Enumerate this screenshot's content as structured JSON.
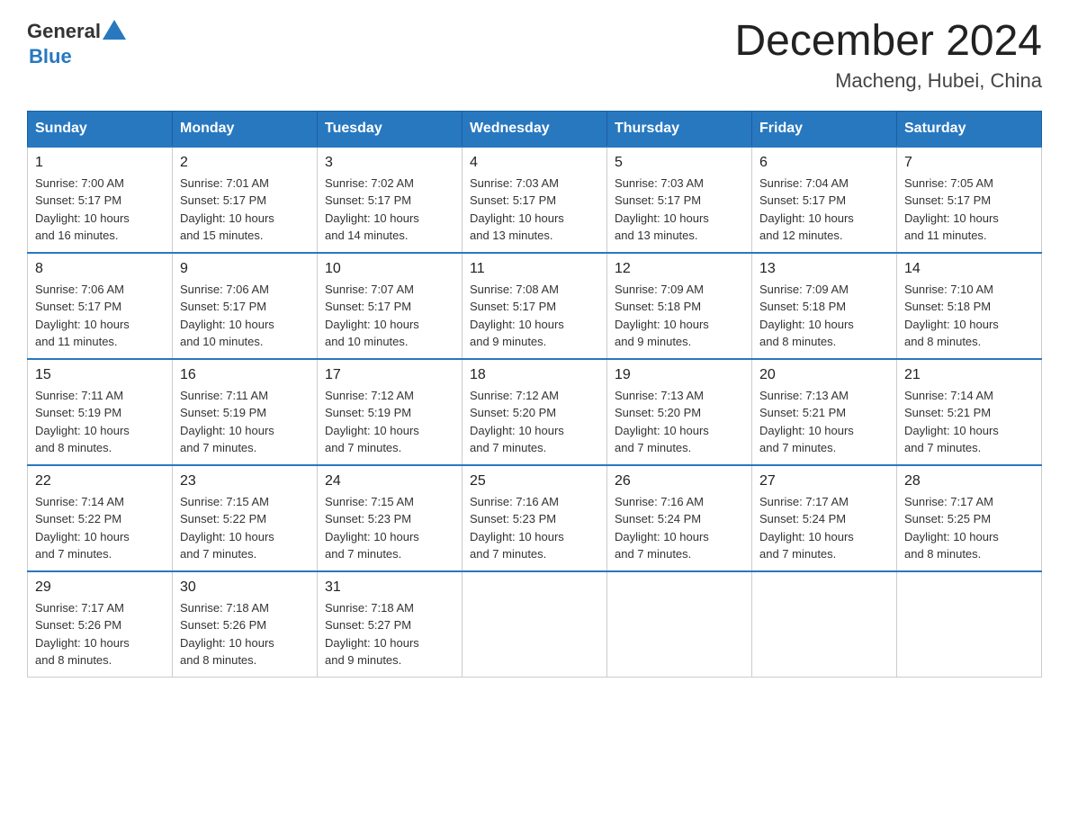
{
  "header": {
    "logo_general": "General",
    "logo_blue": "Blue",
    "title": "December 2024",
    "subtitle": "Macheng, Hubei, China"
  },
  "days_of_week": [
    "Sunday",
    "Monday",
    "Tuesday",
    "Wednesday",
    "Thursday",
    "Friday",
    "Saturday"
  ],
  "weeks": [
    [
      {
        "day": "1",
        "sunrise": "7:00 AM",
        "sunset": "5:17 PM",
        "daylight": "10 hours and 16 minutes."
      },
      {
        "day": "2",
        "sunrise": "7:01 AM",
        "sunset": "5:17 PM",
        "daylight": "10 hours and 15 minutes."
      },
      {
        "day": "3",
        "sunrise": "7:02 AM",
        "sunset": "5:17 PM",
        "daylight": "10 hours and 14 minutes."
      },
      {
        "day": "4",
        "sunrise": "7:03 AM",
        "sunset": "5:17 PM",
        "daylight": "10 hours and 13 minutes."
      },
      {
        "day": "5",
        "sunrise": "7:03 AM",
        "sunset": "5:17 PM",
        "daylight": "10 hours and 13 minutes."
      },
      {
        "day": "6",
        "sunrise": "7:04 AM",
        "sunset": "5:17 PM",
        "daylight": "10 hours and 12 minutes."
      },
      {
        "day": "7",
        "sunrise": "7:05 AM",
        "sunset": "5:17 PM",
        "daylight": "10 hours and 11 minutes."
      }
    ],
    [
      {
        "day": "8",
        "sunrise": "7:06 AM",
        "sunset": "5:17 PM",
        "daylight": "10 hours and 11 minutes."
      },
      {
        "day": "9",
        "sunrise": "7:06 AM",
        "sunset": "5:17 PM",
        "daylight": "10 hours and 10 minutes."
      },
      {
        "day": "10",
        "sunrise": "7:07 AM",
        "sunset": "5:17 PM",
        "daylight": "10 hours and 10 minutes."
      },
      {
        "day": "11",
        "sunrise": "7:08 AM",
        "sunset": "5:17 PM",
        "daylight": "10 hours and 9 minutes."
      },
      {
        "day": "12",
        "sunrise": "7:09 AM",
        "sunset": "5:18 PM",
        "daylight": "10 hours and 9 minutes."
      },
      {
        "day": "13",
        "sunrise": "7:09 AM",
        "sunset": "5:18 PM",
        "daylight": "10 hours and 8 minutes."
      },
      {
        "day": "14",
        "sunrise": "7:10 AM",
        "sunset": "5:18 PM",
        "daylight": "10 hours and 8 minutes."
      }
    ],
    [
      {
        "day": "15",
        "sunrise": "7:11 AM",
        "sunset": "5:19 PM",
        "daylight": "10 hours and 8 minutes."
      },
      {
        "day": "16",
        "sunrise": "7:11 AM",
        "sunset": "5:19 PM",
        "daylight": "10 hours and 7 minutes."
      },
      {
        "day": "17",
        "sunrise": "7:12 AM",
        "sunset": "5:19 PM",
        "daylight": "10 hours and 7 minutes."
      },
      {
        "day": "18",
        "sunrise": "7:12 AM",
        "sunset": "5:20 PM",
        "daylight": "10 hours and 7 minutes."
      },
      {
        "day": "19",
        "sunrise": "7:13 AM",
        "sunset": "5:20 PM",
        "daylight": "10 hours and 7 minutes."
      },
      {
        "day": "20",
        "sunrise": "7:13 AM",
        "sunset": "5:21 PM",
        "daylight": "10 hours and 7 minutes."
      },
      {
        "day": "21",
        "sunrise": "7:14 AM",
        "sunset": "5:21 PM",
        "daylight": "10 hours and 7 minutes."
      }
    ],
    [
      {
        "day": "22",
        "sunrise": "7:14 AM",
        "sunset": "5:22 PM",
        "daylight": "10 hours and 7 minutes."
      },
      {
        "day": "23",
        "sunrise": "7:15 AM",
        "sunset": "5:22 PM",
        "daylight": "10 hours and 7 minutes."
      },
      {
        "day": "24",
        "sunrise": "7:15 AM",
        "sunset": "5:23 PM",
        "daylight": "10 hours and 7 minutes."
      },
      {
        "day": "25",
        "sunrise": "7:16 AM",
        "sunset": "5:23 PM",
        "daylight": "10 hours and 7 minutes."
      },
      {
        "day": "26",
        "sunrise": "7:16 AM",
        "sunset": "5:24 PM",
        "daylight": "10 hours and 7 minutes."
      },
      {
        "day": "27",
        "sunrise": "7:17 AM",
        "sunset": "5:24 PM",
        "daylight": "10 hours and 7 minutes."
      },
      {
        "day": "28",
        "sunrise": "7:17 AM",
        "sunset": "5:25 PM",
        "daylight": "10 hours and 8 minutes."
      }
    ],
    [
      {
        "day": "29",
        "sunrise": "7:17 AM",
        "sunset": "5:26 PM",
        "daylight": "10 hours and 8 minutes."
      },
      {
        "day": "30",
        "sunrise": "7:18 AM",
        "sunset": "5:26 PM",
        "daylight": "10 hours and 8 minutes."
      },
      {
        "day": "31",
        "sunrise": "7:18 AM",
        "sunset": "5:27 PM",
        "daylight": "10 hours and 9 minutes."
      },
      null,
      null,
      null,
      null
    ]
  ],
  "labels": {
    "sunrise": "Sunrise:",
    "sunset": "Sunset:",
    "daylight": "Daylight:"
  }
}
